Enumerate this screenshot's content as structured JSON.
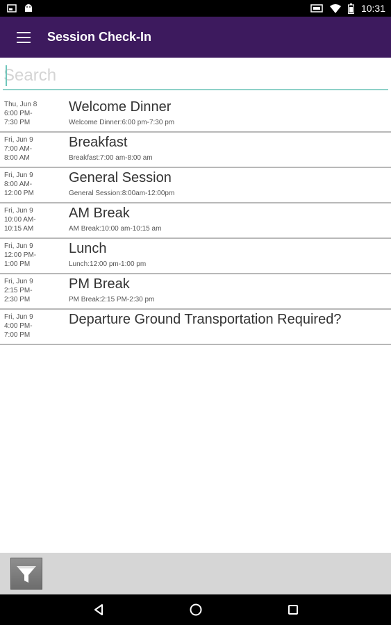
{
  "status_bar": {
    "time": "10:31",
    "left_icons": [
      "gallery-icon",
      "android-icon"
    ],
    "right_icons": [
      "cast-icon",
      "wifi-icon",
      "battery-icon"
    ]
  },
  "app_bar": {
    "title": "Session Check-In",
    "background": "#3d1a5e"
  },
  "search": {
    "placeholder": "Search",
    "value": ""
  },
  "sessions": [
    {
      "date": "Thu, Jun 8",
      "time": "6:00 PM-\n7:30 PM",
      "title": "Welcome Dinner",
      "subtitle": "Welcome Dinner:6:00 pm-7:30 pm"
    },
    {
      "date": "Fri, Jun 9",
      "time": "7:00 AM-\n8:00 AM",
      "title": "Breakfast",
      "subtitle": "Breakfast:7:00 am-8:00 am"
    },
    {
      "date": "Fri, Jun 9",
      "time": "8:00 AM-\n12:00 PM",
      "title": "General Session",
      "subtitle": "General Session:8:00am-12:00pm"
    },
    {
      "date": "Fri, Jun 9",
      "time": "10:00 AM-\n10:15 AM",
      "title": "AM Break",
      "subtitle": "AM Break:10:00 am-10:15 am"
    },
    {
      "date": "Fri, Jun 9",
      "time": "12:00 PM-\n1:00 PM",
      "title": "Lunch",
      "subtitle": "Lunch:12:00 pm-1:00 pm"
    },
    {
      "date": "Fri, Jun 9",
      "time": "2:15 PM-\n2:30 PM",
      "title": "PM Break",
      "subtitle": "PM Break:2:15 PM-2:30 pm"
    },
    {
      "date": "Fri, Jun 9",
      "time": "4:00 PM-\n7:00 PM",
      "title": "Departure Ground Transportation Required?",
      "subtitle": ""
    }
  ],
  "bottom_bar": {
    "filter_icon": "funnel-icon"
  },
  "nav_bar": {
    "buttons": [
      "back-icon",
      "home-icon",
      "recents-icon"
    ]
  }
}
